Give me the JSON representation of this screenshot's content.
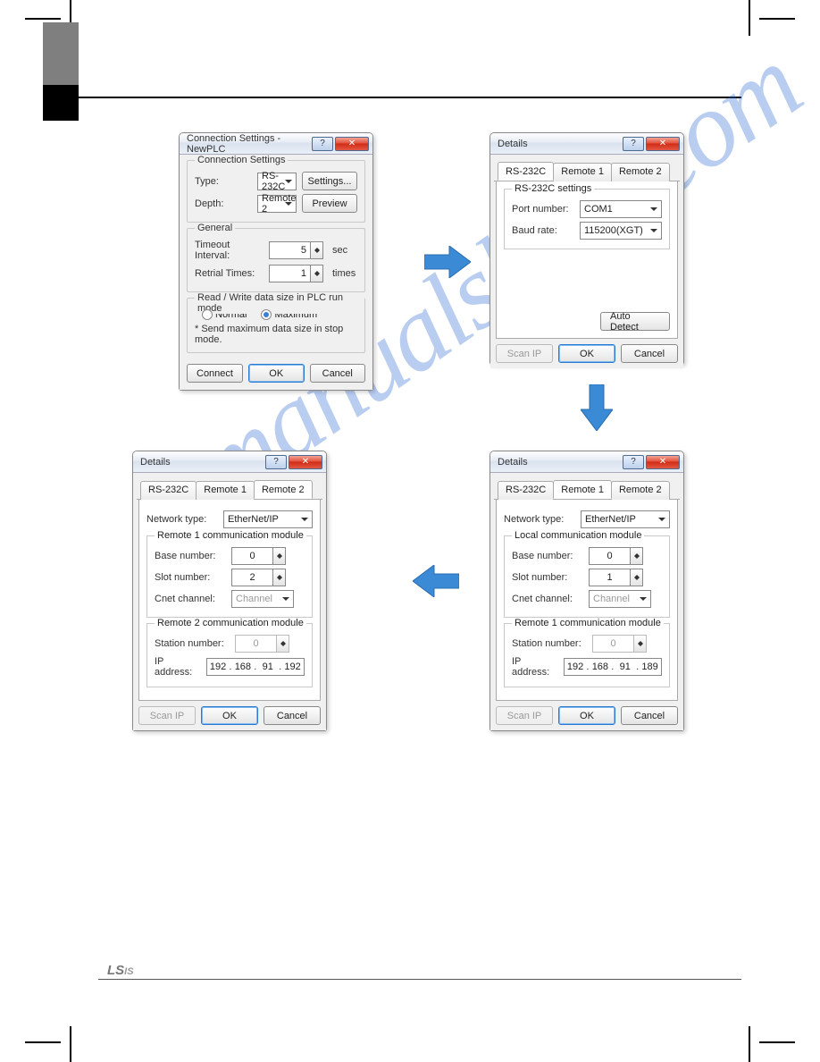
{
  "watermark": "manualshive.com",
  "footer_logo": "LS is",
  "dlg1": {
    "title": "Connection Settings - NewPLC",
    "grp_conn": "Connection Settings",
    "type_label": "Type:",
    "type_value": "RS-232C",
    "settings_btn": "Settings...",
    "depth_label": "Depth:",
    "depth_value": "Remote 2",
    "preview_btn": "Preview",
    "grp_gen": "General",
    "timeout_label": "Timeout Interval:",
    "timeout_value": "5",
    "timeout_unit": "sec",
    "retrial_label": "Retrial Times:",
    "retrial_value": "1",
    "retrial_unit": "times",
    "grp_rw": "Read / Write data size in PLC run mode",
    "radio_normal": "Normal",
    "radio_max": "Maximum",
    "note": "* Send maximum data size in stop mode.",
    "connect_btn": "Connect",
    "ok_btn": "OK",
    "cancel_btn": "Cancel"
  },
  "dlg2": {
    "title": "Details",
    "tab1": "RS-232C",
    "tab2": "Remote 1",
    "tab3": "Remote 2",
    "grp_rs": "RS-232C settings",
    "port_label": "Port number:",
    "port_value": "COM1",
    "baud_label": "Baud rate:",
    "baud_value": "115200(XGT)",
    "autodetect_btn": "Auto Detect",
    "scanip_btn": "Scan IP",
    "ok_btn": "OK",
    "cancel_btn": "Cancel"
  },
  "dlg3": {
    "title": "Details",
    "tab1": "RS-232C",
    "tab2": "Remote 1",
    "tab3": "Remote 2",
    "net_label": "Network type:",
    "net_value": "EtherNet/IP",
    "grp_local": "Local communication module",
    "base_label": "Base number:",
    "base_value": "0",
    "slot_label": "Slot number:",
    "slot_value": "1",
    "cnet_label": "Cnet channel:",
    "cnet_value": "Channel",
    "grp_r1": "Remote 1 communication module",
    "station_label": "Station number:",
    "station_value": "0",
    "ip_label": "IP address:",
    "ip1": "192",
    "ip2": "168",
    "ip3": "91",
    "ip4": "189",
    "scanip_btn": "Scan IP",
    "ok_btn": "OK",
    "cancel_btn": "Cancel"
  },
  "dlg4": {
    "title": "Details",
    "tab1": "RS-232C",
    "tab2": "Remote 1",
    "tab3": "Remote 2",
    "net_label": "Network type:",
    "net_value": "EtherNet/IP",
    "grp_r1": "Remote 1 communication module",
    "base_label": "Base number:",
    "base_value": "0",
    "slot_label": "Slot number:",
    "slot_value": "2",
    "cnet_label": "Cnet channel:",
    "cnet_value": "Channel",
    "grp_r2": "Remote 2 communication module",
    "station_label": "Station number:",
    "station_value": "0",
    "ip_label": "IP address:",
    "ip1": "192",
    "ip2": "168",
    "ip3": "91",
    "ip4": "192",
    "scanip_btn": "Scan IP",
    "ok_btn": "OK",
    "cancel_btn": "Cancel"
  }
}
